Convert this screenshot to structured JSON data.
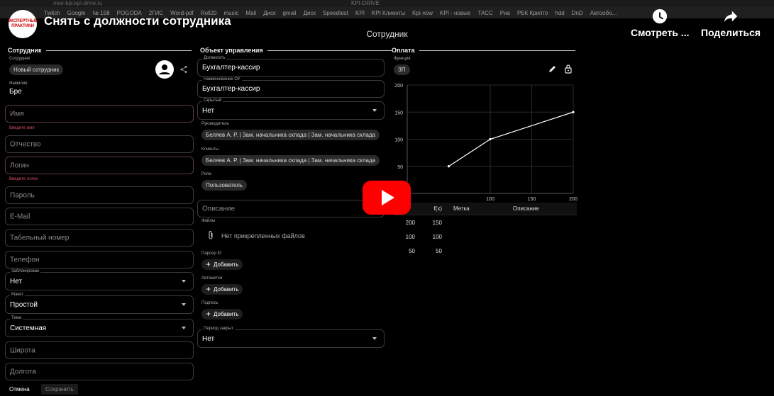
{
  "browser": {
    "url": "new-kpi.kpi-drive.ru",
    "tab_title": "KPI-DRIVE",
    "bookmarks": [
      "Twitch",
      "Google",
      "№ 158",
      "POGODA",
      "2ГИС",
      "Word-pdf",
      "Roll20",
      "music",
      "Mail",
      "Диск",
      "gmail",
      "Диск",
      "Speedtest",
      "KPI",
      "KPI Клиенты",
      "Kpi-now",
      "KPI - новые",
      "ТАСС",
      "Риа",
      "РБК Крипто",
      "hdd",
      "DnD",
      "Автообо..."
    ]
  },
  "youtube": {
    "channel_logo_text": "ЭКСПЕРТНЫЕ ПРАКТИКИ",
    "video_title": "Снять с должности сотрудника",
    "watch_later": "Смотреть ...",
    "share": "Поделиться"
  },
  "page": {
    "title": "Сотрудник"
  },
  "employee": {
    "header": "Сотрудник",
    "employee_label": "Сотрудник",
    "employee_chip": "Новый сотрудник",
    "lastname_label": "Фамилия",
    "lastname_value": "Бре",
    "firstname_placeholder": "Имя",
    "firstname_error": "Введите имя",
    "patronymic_placeholder": "Отчество",
    "login_placeholder": "Логин",
    "login_error": "Введите логин",
    "password_placeholder": "Пароль",
    "email_placeholder": "E-Mail",
    "tabnum_placeholder": "Табельный номер",
    "phone_placeholder": "Телефон",
    "blocked_label": "Заблокирован",
    "blocked_value": "Нет",
    "layout_label": "Макет",
    "layout_value": "Простой",
    "theme_label": "Тема",
    "theme_value": "Системная",
    "latitude_placeholder": "Широта",
    "longitude_placeholder": "Долгота",
    "cancel_label": "Отмена",
    "save_label": "Сохранить"
  },
  "org": {
    "header": "Объект управления",
    "position_label": "Должность",
    "position_value": "Бухгалтер-кассир",
    "ou_name_label": "Наименование ОУ",
    "ou_name_value": "Бухгалтер-кассир",
    "hidden_label": "Скрытый",
    "hidden_value": "Нет",
    "head_label": "Руководитель",
    "head_value": "Беляев А. Р. | Зам. начальника склада | Зам. начальника склада",
    "clients_label": "Клиенты",
    "clients_value": "Беляев А. Р. | Зам. начальника склада | Зам. начальника склада",
    "roles_label": "Роли",
    "roles_value": "Пользователь",
    "description_placeholder": "Описание",
    "files_label": "Файлы",
    "files_empty": "Нет прикрепленных файлов",
    "parser_label": "Парсер ID",
    "autotags_label": "Автометки",
    "signature_label": "Подпись",
    "add_label": "Добавить",
    "period_closed_label": "Период закрыт",
    "period_closed_value": "Нет"
  },
  "payment": {
    "header": "Оплата",
    "function_label": "Функция",
    "function_chip": "ЗП",
    "table_headers": [
      "",
      "f(x)",
      "Метка",
      "Описание"
    ],
    "rows": [
      [
        "200",
        "150",
        "",
        ""
      ],
      [
        "100",
        "100",
        "",
        ""
      ],
      [
        "50",
        "50",
        "",
        ""
      ]
    ]
  },
  "chart_data": {
    "type": "line",
    "x": [
      50,
      100,
      200
    ],
    "series": [
      {
        "values": [
          50,
          100,
          150
        ]
      }
    ],
    "xlim": [
      0,
      200
    ],
    "ylim": [
      0,
      200
    ],
    "x_ticks": [
      100,
      150,
      200
    ],
    "y_ticks": [
      50,
      100,
      150,
      200
    ],
    "grid": true,
    "line_color": "#ffffff",
    "grid_color": "#2a2a2a"
  }
}
